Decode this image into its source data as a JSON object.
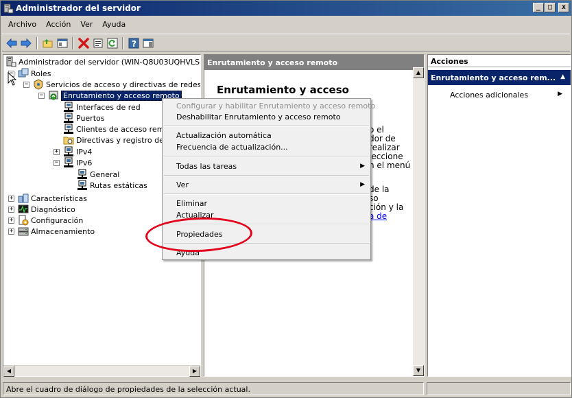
{
  "window": {
    "title": "Administrador del servidor",
    "buttons": {
      "minimize": "_",
      "maximize": "□",
      "close": "x"
    }
  },
  "menubar": {
    "items": [
      "Archivo",
      "Acción",
      "Ver",
      "Ayuda"
    ]
  },
  "tree": {
    "root": "Administrador del servidor (WIN-Q8U03UQHVLS)",
    "roles": "Roles",
    "services": "Servicios de acceso y directivas de redes",
    "rras": "Enrutamiento y acceso remoto",
    "interfaces": "Interfaces de red",
    "ports": "Puertos",
    "clients": "Clientes de acceso remot",
    "policies": "Directivas y registro de a",
    "ipv4": "IPv4",
    "ipv6": "IPv6",
    "general": "General",
    "static_routes": "Rutas estáticas",
    "features": "Características",
    "diagnostics": "Diagnóstico",
    "configuration": "Configuración",
    "storage": "Almacenamiento"
  },
  "middle": {
    "header": "Enrutamiento y acceso remoto",
    "heading": "Enrutamiento y acceso",
    "fragments": [
      "o el",
      "dor de",
      "realizar",
      "leccione",
      "n el menú",
      "de la",
      "so",
      "ción y la"
    ],
    "link_fragment": "a de"
  },
  "actions": {
    "header": "Acciones",
    "section": "Enrutamiento y acceso rem...",
    "item": "Acciones adicionales"
  },
  "context_menu": {
    "configure": "Configurar y habilitar Enrutamiento y acceso remoto",
    "disable": "Deshabilitar Enrutamiento y acceso remoto",
    "auto_update": "Actualización automática",
    "update_freq": "Frecuencia de actualización...",
    "all_tasks": "Todas las tareas",
    "view": "Ver",
    "delete": "Eliminar",
    "refresh": "Actualizar",
    "properties": "Propiedades",
    "help": "Ayuda"
  },
  "statusbar": {
    "text": "Abre el cuadro de diálogo de propiedades de la selección actual."
  },
  "colors": {
    "titlebar": "#0a246a",
    "selection": "#0a246a",
    "annotation": "#e3001b",
    "link": "#0000ee"
  }
}
